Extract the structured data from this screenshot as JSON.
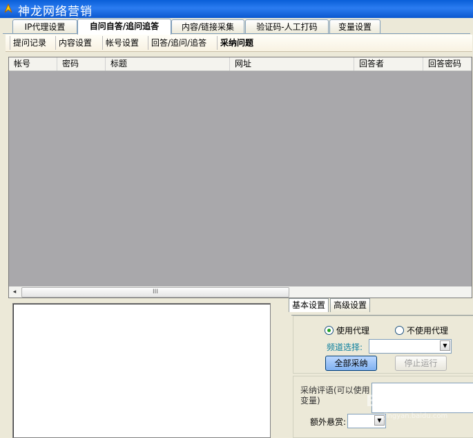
{
  "app": {
    "title": "神龙网络营销"
  },
  "main_tabs": [
    {
      "label": "IP代理设置"
    },
    {
      "label": "自问自答/追问追答"
    },
    {
      "label": "内容/链接采集"
    },
    {
      "label": "验证码-人工打码"
    },
    {
      "label": "变量设置"
    }
  ],
  "sub_tabs": [
    {
      "label": "提问记录"
    },
    {
      "label": "内容设置"
    },
    {
      "label": "帐号设置"
    },
    {
      "label": "回答/追问/追答"
    },
    {
      "label": "采纳问题"
    }
  ],
  "grid": {
    "columns": [
      "帐号",
      "密码",
      "标题",
      "网址",
      "回答者",
      "回答密码"
    ],
    "rows": [],
    "scroll_left": "◂",
    "scroll_thumb": "III"
  },
  "settings_tabs": [
    {
      "label": "基本设置"
    },
    {
      "label": "高级设置"
    }
  ],
  "basic": {
    "use_proxy": "使用代理",
    "no_proxy": "不使用代理",
    "channel_label": "频道选择:",
    "channel_value": "",
    "accept_all_button": "全部采纳",
    "stop_button": "停止运行",
    "comment_label": "采纳评语(可以使用变量)",
    "bounty_label": "额外悬赏:",
    "bounty_value": ""
  },
  "watermark": {
    "text": "Baidu经验",
    "url": "jingyan.baidu.com"
  },
  "colors": {
    "titlebar": "#0a5fd8",
    "grid_bg": "#a9a8ab",
    "window_bg": "#ece9d8"
  }
}
